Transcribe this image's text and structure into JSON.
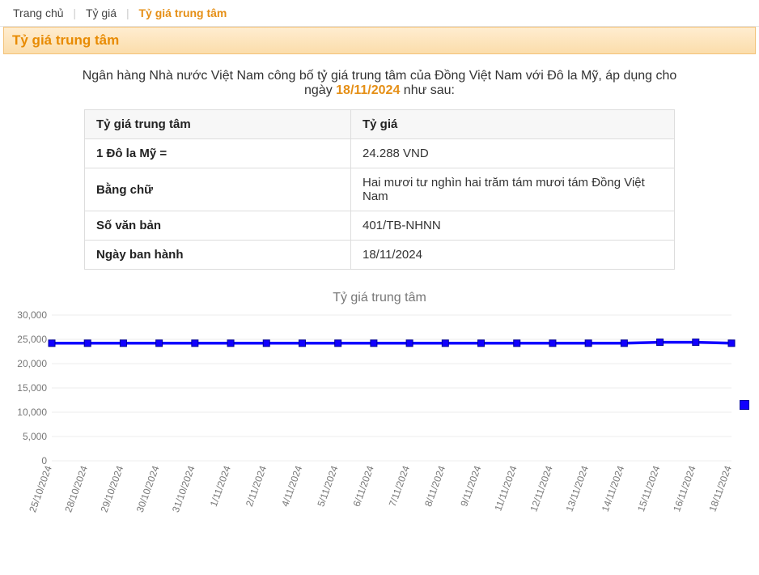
{
  "breadcrumb": {
    "home": "Trang chủ",
    "rates": "Tỷ giá",
    "central_rate": "Tỷ giá trung tâm"
  },
  "titlebar": "Tỷ giá trung tâm",
  "announce": {
    "pre": "Ngân hàng Nhà nước Việt Nam công bố tỷ giá trung tâm của Đồng Việt Nam với Đô la Mỹ, áp dụng cho ngày ",
    "date": "18/11/2024",
    "post": " như sau:"
  },
  "table": {
    "head_left": "Tỷ giá trung tâm",
    "head_right": "Tỷ giá",
    "rows": [
      {
        "label": "1 Đô la Mỹ =",
        "value": "24.288 VND"
      },
      {
        "label": "Bằng chữ",
        "value": "Hai mươi tư nghìn hai trăm tám mươi tám Đồng Việt Nam"
      },
      {
        "label": "Số văn bản",
        "value": "401/TB-NHNN"
      },
      {
        "label": "Ngày ban hành",
        "value": "18/11/2024"
      }
    ]
  },
  "chart_title": "Tỷ giá trung tâm",
  "chart_data": {
    "type": "line",
    "xlabel": "",
    "ylabel": "",
    "ylim": [
      0,
      30000
    ],
    "yticks": [
      0,
      5000,
      10000,
      15000,
      20000,
      25000,
      30000
    ],
    "ytick_labels": [
      "0",
      "5,000",
      "10,000",
      "15,000",
      "20,000",
      "25,000",
      "30,000"
    ],
    "categories": [
      "25/10/2024",
      "28/10/2024",
      "29/10/2024",
      "30/10/2024",
      "31/10/2024",
      "1/11/2024",
      "2/11/2024",
      "4/11/2024",
      "5/11/2024",
      "6/11/2024",
      "7/11/2024",
      "8/11/2024",
      "9/11/2024",
      "11/11/2024",
      "12/11/2024",
      "13/11/2024",
      "14/11/2024",
      "15/11/2024",
      "16/11/2024",
      "18/11/2024"
    ],
    "series": [
      {
        "name": "Tỷ giá trung tâm",
        "values": [
          24200,
          24200,
          24200,
          24200,
          24200,
          24200,
          24200,
          24200,
          24200,
          24200,
          24200,
          24200,
          24200,
          24200,
          24200,
          24200,
          24200,
          24400,
          24400,
          24200
        ]
      }
    ]
  }
}
